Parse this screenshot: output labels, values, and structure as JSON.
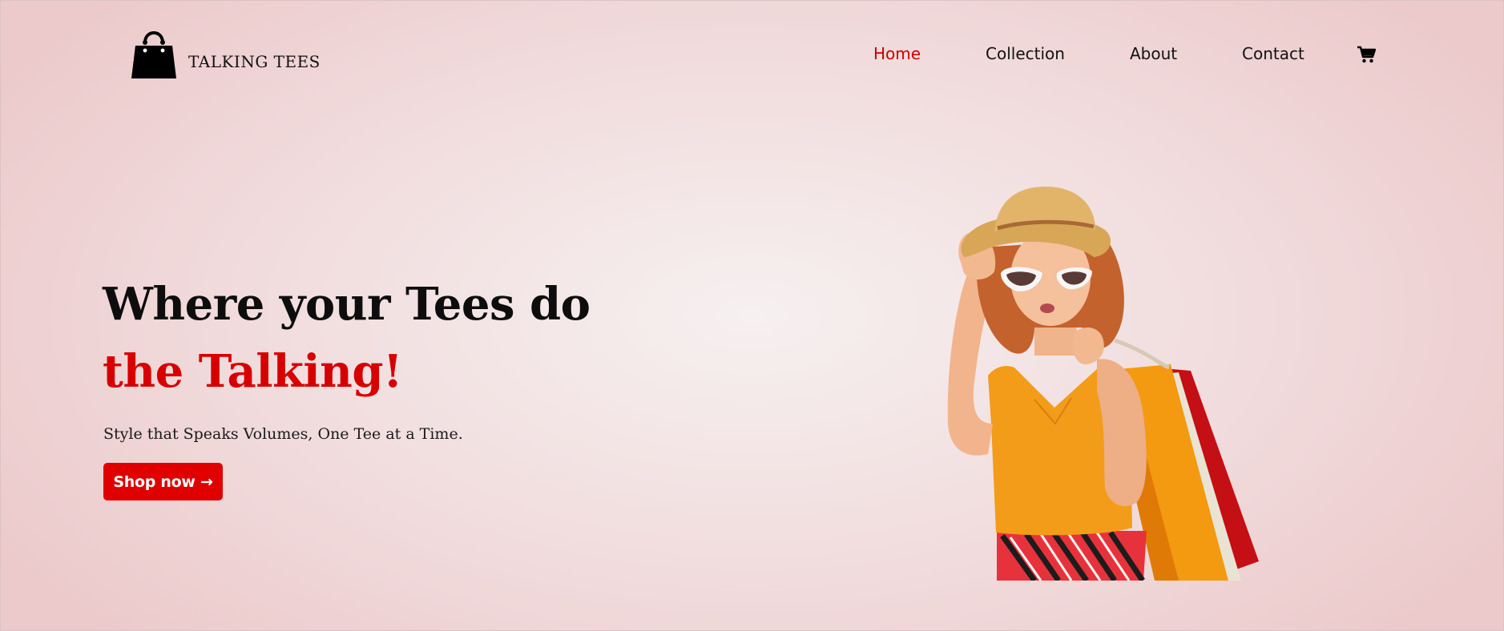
{
  "brand": {
    "name": "TALKING TEES",
    "logo_icon": "shopping-bag-icon"
  },
  "nav": {
    "items": [
      {
        "label": "Home",
        "active": true
      },
      {
        "label": "Collection",
        "active": false
      },
      {
        "label": "About",
        "active": false
      },
      {
        "label": "Contact",
        "active": false
      }
    ],
    "cart_icon": "cart-icon"
  },
  "hero": {
    "title_line1": "Where your Tees do",
    "title_line2": "the Talking!",
    "tagline": "Style that Speaks Volumes, One Tee at a Time.",
    "cta_label": "Shop now →",
    "image": "woman-with-shopping-bags"
  },
  "colors": {
    "accent": "#d70000",
    "button": "#e00000",
    "nav_active": "#cc0000",
    "background": "#f1dcdd",
    "text": "#111111"
  }
}
